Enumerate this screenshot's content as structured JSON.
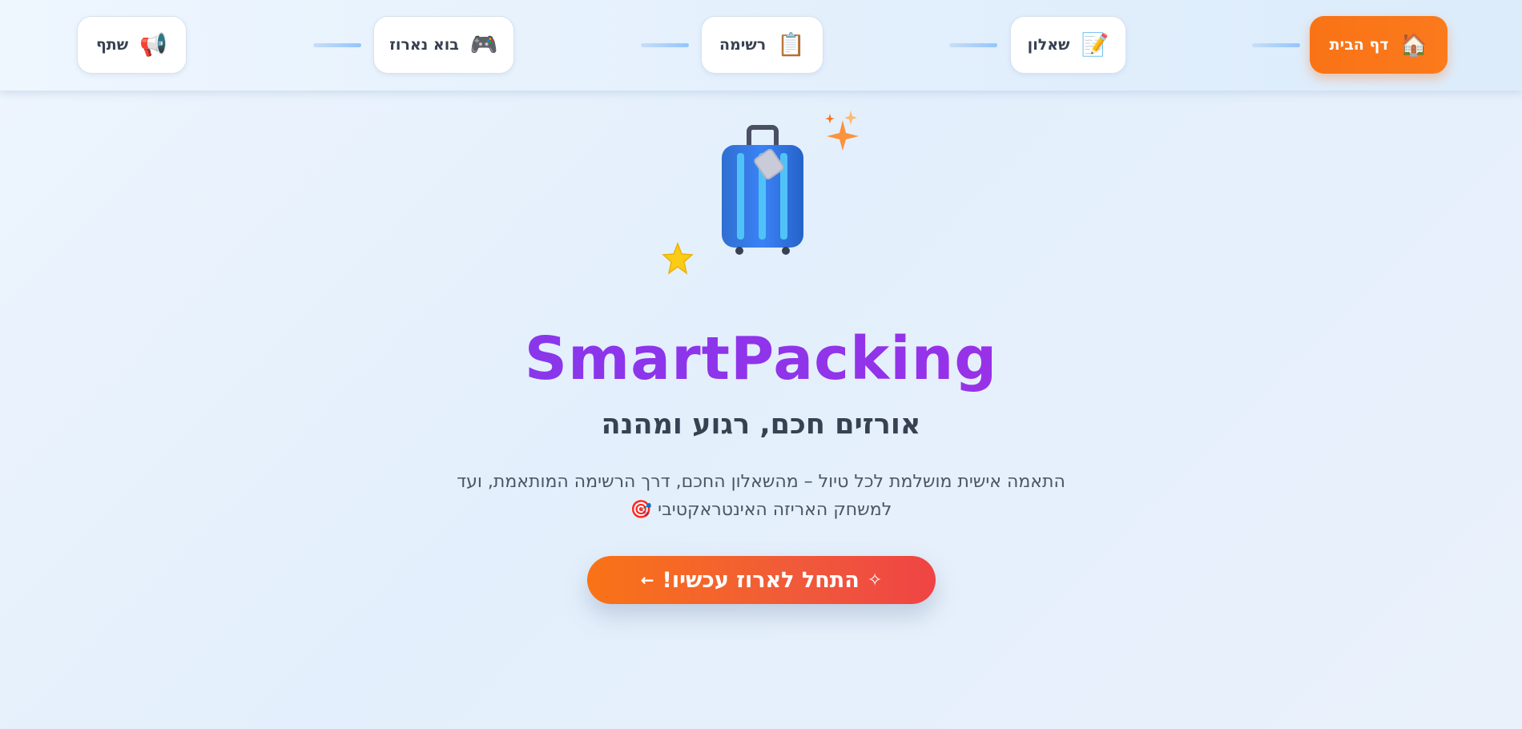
{
  "nav": {
    "steps": [
      {
        "label": "דף הבית",
        "icon": "house-icon",
        "glyph": "🏠",
        "active": true
      },
      {
        "label": "שאלון",
        "icon": "memo-icon",
        "glyph": "📝",
        "active": false
      },
      {
        "label": "רשימה",
        "icon": "clipboard-icon",
        "glyph": "📋",
        "active": false
      },
      {
        "label": "בוא נארוז",
        "icon": "game-controller-icon",
        "glyph": "🎮",
        "active": false
      },
      {
        "label": "שתף",
        "icon": "megaphone-icon",
        "glyph": "📢",
        "active": false
      }
    ]
  },
  "hero": {
    "icon": "suitcase-icon",
    "title": "SmartPacking",
    "subtitle": "אורזים חכם, רגוע ומהנה",
    "description_line1": "התאמה אישית מושלמת לכל טיול – מהשאלון החכם, דרך הרשימה המותאמת, ועד",
    "description_line2": "למשחק האריזה האינטראקטיבי",
    "description_emoji": "🎯",
    "cta_label": "התחל לארוז עכשיו!",
    "cta_spark": "✧",
    "cta_arrow": "←"
  },
  "colors": {
    "accent_orange": "#f97316",
    "accent_red": "#ef4444",
    "title_purple": "#7c3aed",
    "title_magenta": "#c026d3"
  }
}
